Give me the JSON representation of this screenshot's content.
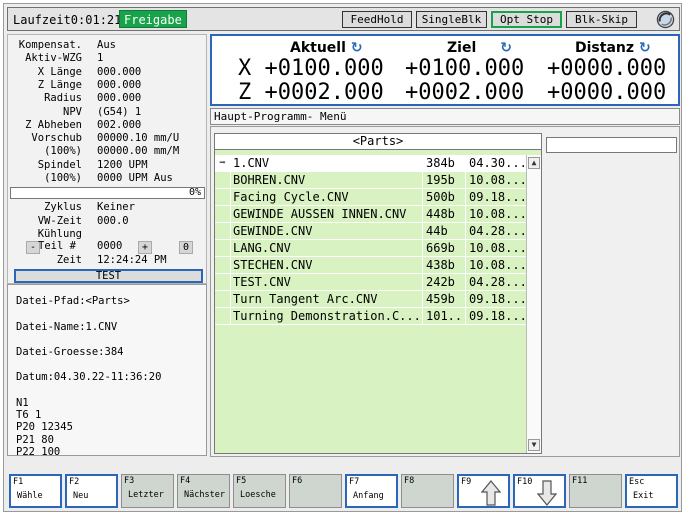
{
  "topbar": {
    "runtime": "Laufzeit0:01:21",
    "release": "Freigabe",
    "buttons": [
      "FeedHold",
      "SingleBlk",
      "Opt Stop",
      "Blk-Skip"
    ]
  },
  "status": {
    "rows": [
      {
        "k": "Kompensat.",
        "v": "Aus"
      },
      {
        "k": "Aktiv-WZG",
        "v": "1"
      },
      {
        "k": "X Länge",
        "v": "000.000"
      },
      {
        "k": "Z Länge",
        "v": "000.000"
      },
      {
        "k": "Radius",
        "v": "000.000"
      },
      {
        "k": "NPV",
        "v": "(G54) 1"
      },
      {
        "k": "Z Abheben",
        "v": "002.000"
      },
      {
        "k": "Vorschub",
        "v": "00000.10 mm/U"
      },
      {
        "k": "(100%)",
        "v": "00000.00 mm/M"
      },
      {
        "k": "Spindel",
        "v": "1200 UPM"
      },
      {
        "k": "(100%)",
        "v": "0000 UPM Aus"
      }
    ],
    "progress": "0%",
    "rows2": [
      {
        "k": "Zyklus",
        "v": "Keiner"
      },
      {
        "k": "VW-Zeit",
        "v": "000.0"
      },
      {
        "k": "Kühlung",
        "v": ""
      }
    ],
    "part_label": "Teil #",
    "part_value": "0000",
    "part_minus": "-",
    "part_plus": "+",
    "part_count": "0",
    "time_label": "Zeit",
    "time_value": "12:24:24 PM",
    "test_label": "TEST"
  },
  "info": {
    "path": "Datei-Pfad:<Parts>",
    "name": "Datei-Name:1.CNV",
    "size": "Datei-Groesse:384",
    "date": "Datum:04.30.22-11:36:20",
    "code": [
      "N1",
      "T6 1",
      "P20 12345",
      "P21 80",
      "P22 100"
    ]
  },
  "position": {
    "headers": [
      "Aktuell",
      "Ziel",
      "Distanz"
    ],
    "x": [
      "X +0100.000",
      "+0100.000",
      "+0000.000"
    ],
    "z": [
      "Z +0002.000",
      "+0002.000",
      "+0000.000"
    ]
  },
  "menubar": "Haupt-Programm- Menü",
  "filebrowser": {
    "title": "<Parts>",
    "files": [
      {
        "name": "1.CNV",
        "size": "384b",
        "date": "04.30...."
      },
      {
        "name": "BOHREN.CNV",
        "size": "195b",
        "date": "10.08...."
      },
      {
        "name": "Facing Cycle.CNV",
        "size": "500b",
        "date": "09.18...."
      },
      {
        "name": "GEWINDE AUSSEN INNEN.CNV",
        "size": "448b",
        "date": "10.08...."
      },
      {
        "name": "GEWINDE.CNV",
        "size": "44b",
        "date": "04.28...."
      },
      {
        "name": "LANG.CNV",
        "size": "669b",
        "date": "10.08...."
      },
      {
        "name": "STECHEN.CNV",
        "size": "438b",
        "date": "10.08...."
      },
      {
        "name": "TEST.CNV",
        "size": "242b",
        "date": "04.28...."
      },
      {
        "name": "Turn Tangent Arc.CNV",
        "size": "459b",
        "date": "09.18...."
      },
      {
        "name": "Turning Demonstration.C...",
        "size": "101...",
        "date": "09.18...."
      }
    ]
  },
  "fkeys": [
    {
      "n": "F1",
      "l": "Wähle",
      "off": false,
      "icon": ""
    },
    {
      "n": "F2",
      "l": "Neu",
      "off": false,
      "icon": ""
    },
    {
      "n": "F3",
      "l": "Letzter",
      "off": true,
      "icon": ""
    },
    {
      "n": "F4",
      "l": "Nächster",
      "off": true,
      "icon": ""
    },
    {
      "n": "F5",
      "l": "Loesche",
      "off": true,
      "icon": ""
    },
    {
      "n": "F6",
      "l": "",
      "off": true,
      "icon": ""
    },
    {
      "n": "F7",
      "l": "Anfang",
      "off": false,
      "icon": ""
    },
    {
      "n": "F8",
      "l": "",
      "off": true,
      "icon": ""
    },
    {
      "n": "F9",
      "l": "",
      "off": false,
      "icon": "arrow-up-icon"
    },
    {
      "n": "F10",
      "l": "",
      "off": false,
      "icon": "arrow-down-icon"
    },
    {
      "n": "F11",
      "l": "",
      "off": true,
      "icon": ""
    },
    {
      "n": "Esc",
      "l": "Exit",
      "off": false,
      "icon": ""
    }
  ]
}
